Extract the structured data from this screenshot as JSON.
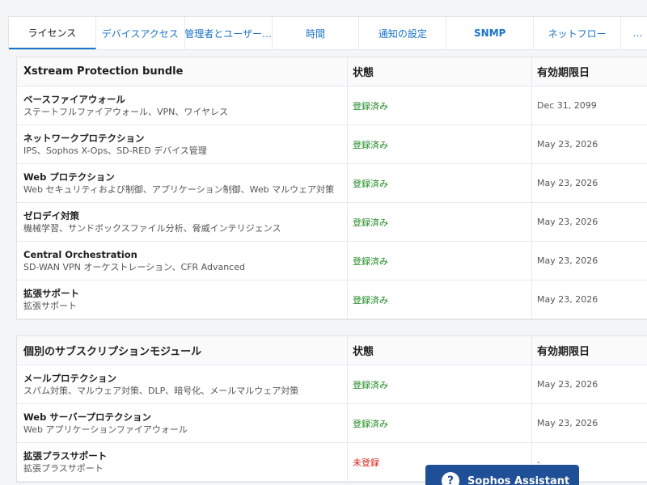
{
  "tabs": [
    {
      "label": "ライセンス",
      "active": true
    },
    {
      "label": "デバイスアクセス"
    },
    {
      "label": "管理者とユーザー…"
    },
    {
      "label": "時間"
    },
    {
      "label": "通知の設定"
    },
    {
      "label": "SNMP"
    },
    {
      "label": "ネットフロー"
    },
    {
      "label": "…"
    }
  ],
  "bundle": {
    "header": {
      "name": "Xstream Protection bundle",
      "status": "状態",
      "expiry": "有効期限日"
    },
    "rows": [
      {
        "name": "ベースファイアウォール",
        "desc": "ステートフルファイアウォール、VPN、ワイヤレス",
        "status": "登録済み",
        "expiry": "Dec 31, 2099"
      },
      {
        "name": "ネットワークプロテクション",
        "desc": "IPS、Sophos X-Ops、SD-RED デバイス管理",
        "status": "登録済み",
        "expiry": "May 23, 2026"
      },
      {
        "name": "Web プロテクション",
        "desc": "Web セキュリティおよび制御、アプリケーション制御、Web マルウェア対策",
        "status": "登録済み",
        "expiry": "May 23, 2026"
      },
      {
        "name": "ゼロデイ対策",
        "desc": "機械学習、サンドボックスファイル分析、脅威インテリジェンス",
        "status": "登録済み",
        "expiry": "May 23, 2026"
      },
      {
        "name": "Central Orchestration",
        "desc": "SD-WAN VPN オーケストレーション、CFR Advanced",
        "status": "登録済み",
        "expiry": "May 23, 2026"
      },
      {
        "name": "拡張サポート",
        "desc": "拡張サポート",
        "status": "登録済み",
        "expiry": "May 23, 2026"
      }
    ]
  },
  "modules": {
    "header": {
      "name": "個別のサブスクリプションモジュール",
      "status": "状態",
      "expiry": "有効期限日"
    },
    "rows": [
      {
        "name": "メールプロテクション",
        "desc": "スパム対策、マルウェア対策、DLP、暗号化、メールマルウェア対策",
        "status": "登録済み",
        "expiry": "May 23, 2026"
      },
      {
        "name": "Web サーバープロテクション",
        "desc": "Web アプリケーションファイアウォール",
        "status": "登録済み",
        "expiry": "May 23, 2026"
      },
      {
        "name": "拡張プラスサポート",
        "desc": "拡張プラスサポート",
        "status": "未登録",
        "status_kind": "unregistered",
        "expiry": "-"
      }
    ]
  },
  "assistant": {
    "label": "Sophos Assistant",
    "icon": "?"
  },
  "colors": {
    "accent": "#1a74c8",
    "registered": "#1d8a22",
    "unregistered": "#d9201c",
    "assistant_bg": "#1f4f97"
  }
}
